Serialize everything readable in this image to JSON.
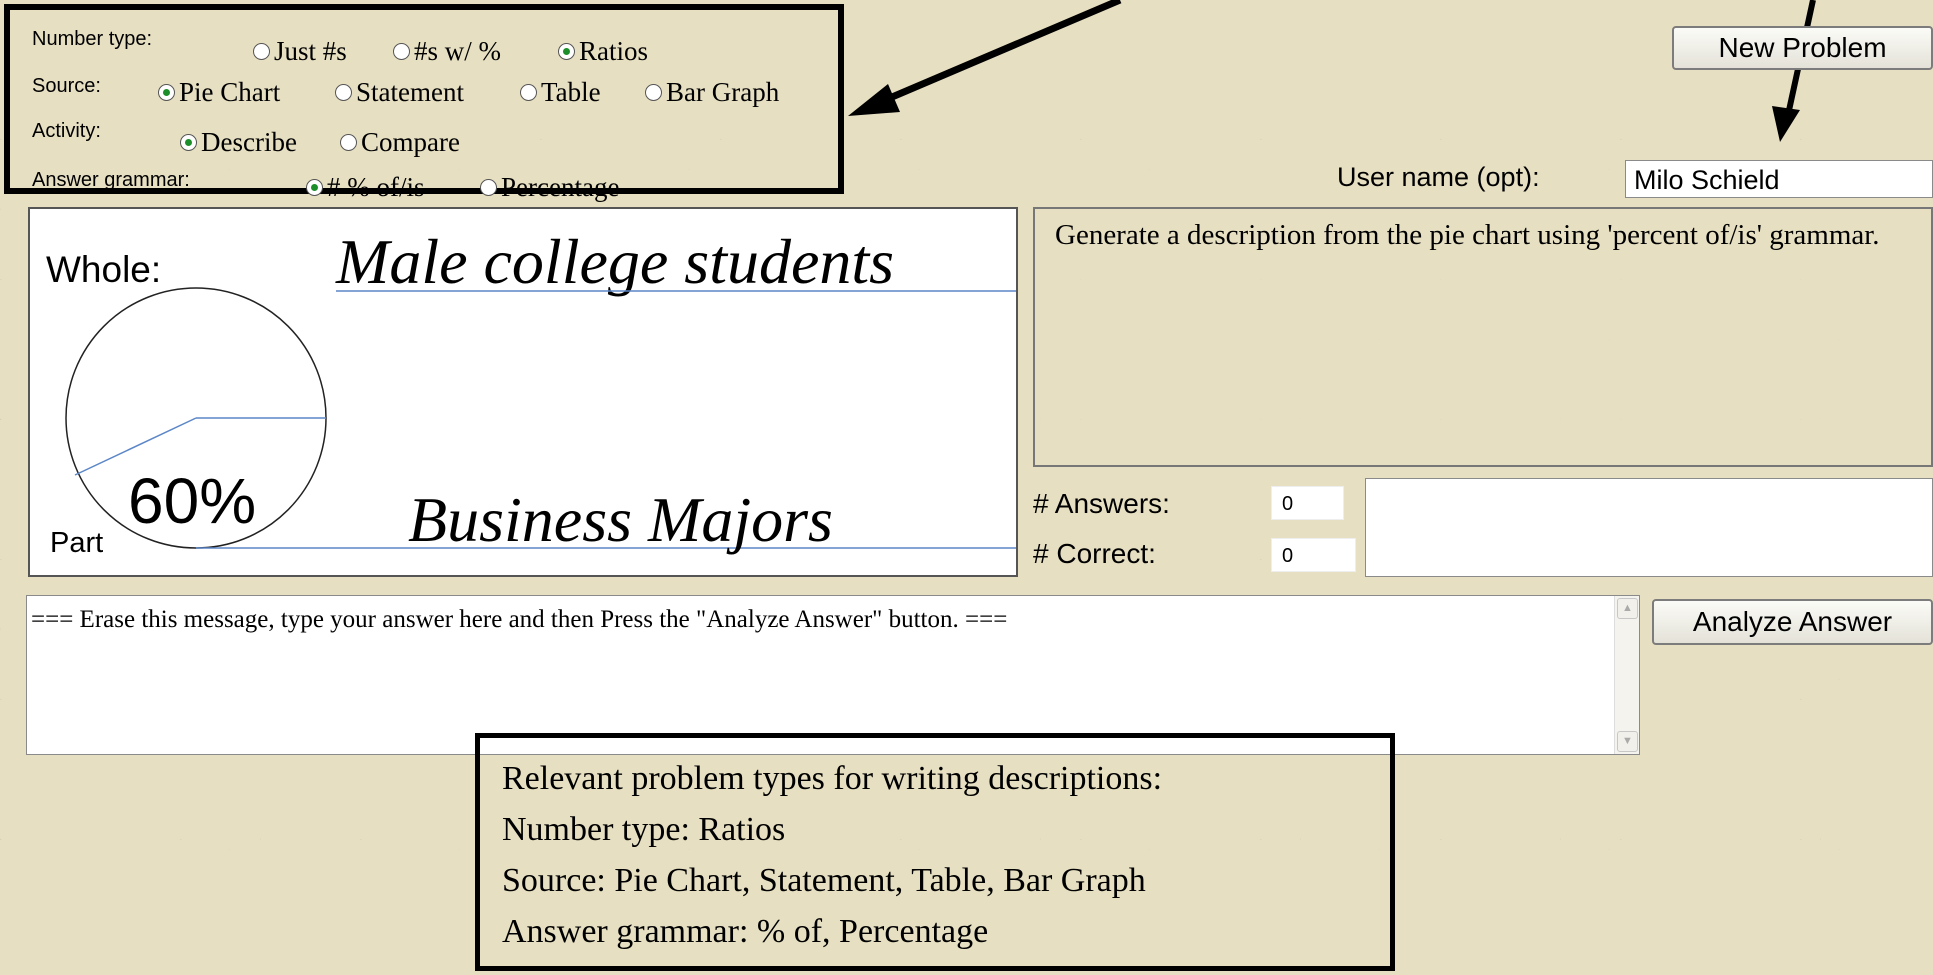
{
  "options": {
    "number_type": {
      "label": "Number type:",
      "choices": [
        "Just #s",
        "#s w/ %",
        "Ratios"
      ],
      "selected": "Ratios"
    },
    "source": {
      "label": "Source:",
      "choices": [
        "Pie Chart",
        "Statement",
        "Table",
        "Bar Graph"
      ],
      "selected": "Pie Chart"
    },
    "activity": {
      "label": "Activity:",
      "choices": [
        "Describe",
        "Compare"
      ],
      "selected": "Describe"
    },
    "answer_grammar": {
      "label": "Answer grammar:",
      "choices": [
        "# % of/is",
        "Percentage"
      ],
      "selected": "# % of/is"
    }
  },
  "toolbar": {
    "new_problem_label": "New Problem",
    "analyze_label": "Analyze Answer"
  },
  "user": {
    "label": "User name (opt):",
    "value": "Milo Schield"
  },
  "pie": {
    "whole_label": "Whole:",
    "whole_value": "Male college students",
    "part_label": "Part",
    "percent": "60%",
    "part_value": "Business Majors"
  },
  "instructions": "Generate a description from the pie chart using 'percent of/is' grammar.",
  "stats": {
    "answers_label": "# Answers:",
    "answers_value": "0",
    "correct_label": "# Correct:",
    "correct_value": "0"
  },
  "answer": {
    "value": "===  Erase this message, type your answer here and then Press the \"Analyze Answer\" button. ==="
  },
  "callout": {
    "line1": "Relevant problem types for writing descriptions:",
    "line2": "Number type: Ratios",
    "line3": "Source: Pie Chart, Statement, Table, Bar Graph",
    "line4": "Answer grammar:  % of, Percentage"
  },
  "colors": {
    "background": "#e6dfc2",
    "radio_selected": "#1d8f2a",
    "rule_line": "#5b86c7"
  }
}
